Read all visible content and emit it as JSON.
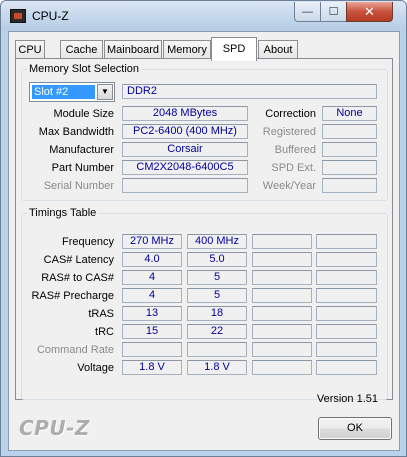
{
  "window": {
    "title": "CPU-Z",
    "minimize_glyph": "—",
    "maximize_glyph": "☐",
    "close_glyph": "✕"
  },
  "tabs": [
    {
      "label": "CPU"
    },
    {
      "label": "Cache"
    },
    {
      "label": "Mainboard"
    },
    {
      "label": "Memory"
    },
    {
      "label": "SPD",
      "active": true
    },
    {
      "label": "About"
    }
  ],
  "memory_slot_selection": {
    "legend": "Memory Slot Selection",
    "slot_value": "Slot #2",
    "dropdown_arrow": "▼",
    "memory_type": "DDR2",
    "fields": {
      "module_size": {
        "label": "Module Size",
        "value": "2048 MBytes"
      },
      "max_bandwidth": {
        "label": "Max Bandwidth",
        "value": "PC2-6400 (400 MHz)"
      },
      "manufacturer": {
        "label": "Manufacturer",
        "value": "Corsair"
      },
      "part_number": {
        "label": "Part Number",
        "value": "CM2X2048-6400C5"
      },
      "serial_number": {
        "label": "Serial Number",
        "value": ""
      }
    },
    "right_fields": {
      "correction": {
        "label": "Correction",
        "value": "None"
      },
      "registered": {
        "label": "Registered",
        "value": ""
      },
      "buffered": {
        "label": "Buffered",
        "value": ""
      },
      "spd_ext": {
        "label": "SPD Ext.",
        "value": ""
      },
      "week_year": {
        "label": "Week/Year",
        "value": ""
      }
    }
  },
  "timings_table": {
    "legend": "Timings Table",
    "rows": [
      {
        "label": "Frequency",
        "values": [
          "270 MHz",
          "400 MHz",
          "",
          ""
        ]
      },
      {
        "label": "CAS# Latency",
        "values": [
          "4.0",
          "5.0",
          "",
          ""
        ]
      },
      {
        "label": "RAS# to CAS#",
        "values": [
          "4",
          "5",
          "",
          ""
        ]
      },
      {
        "label": "RAS# Precharge",
        "values": [
          "4",
          "5",
          "",
          ""
        ]
      },
      {
        "label": "tRAS",
        "values": [
          "13",
          "18",
          "",
          ""
        ]
      },
      {
        "label": "tRC",
        "values": [
          "15",
          "22",
          "",
          ""
        ]
      },
      {
        "label": "Command Rate",
        "values": [
          "",
          "",
          "",
          ""
        ],
        "dim": true
      },
      {
        "label": "Voltage",
        "values": [
          "1.8 V",
          "1.8 V",
          "",
          ""
        ]
      }
    ]
  },
  "footer": {
    "version": "Version 1.51",
    "brand": "CPU-Z",
    "ok_label": "OK"
  },
  "colors": {
    "value_text": "#00009a",
    "selection": "#3399ff",
    "dim_label": "#8a8a8a"
  }
}
